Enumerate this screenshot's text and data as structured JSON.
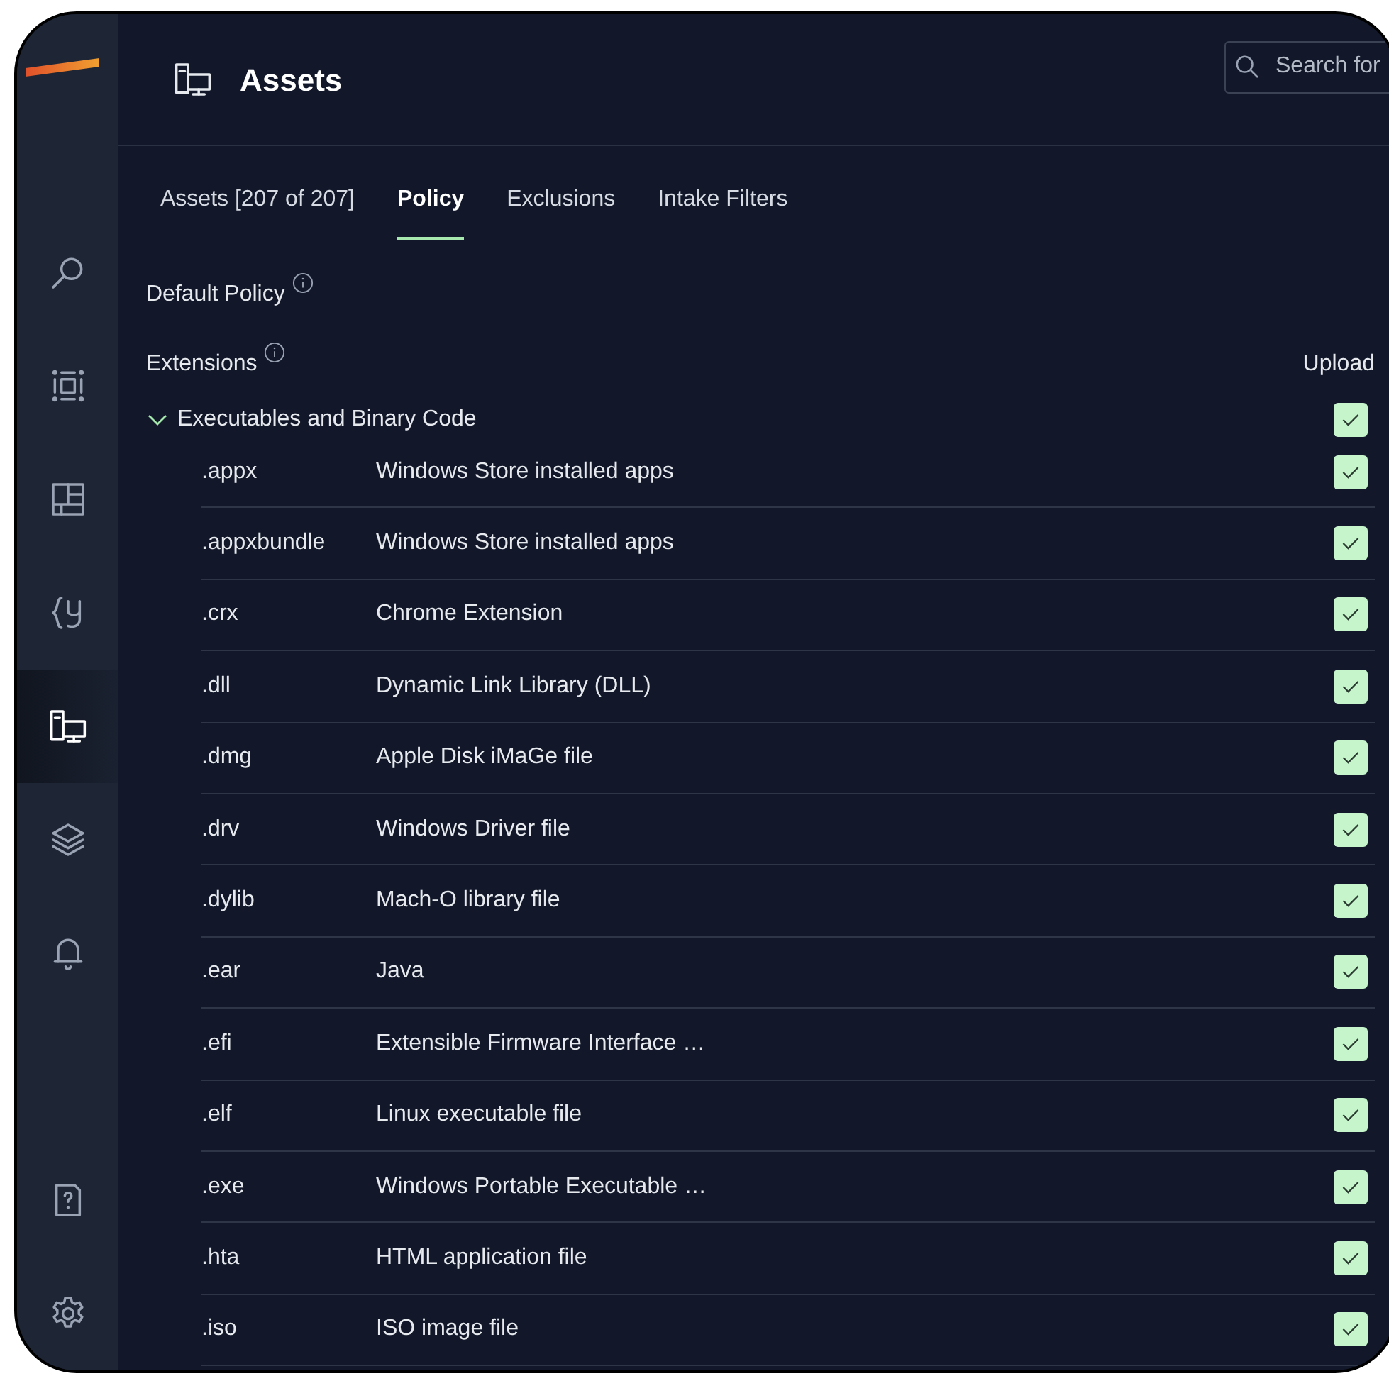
{
  "sidebar": {
    "items": [
      {
        "kind": "search",
        "selected": false
      },
      {
        "kind": "scan",
        "selected": false
      },
      {
        "kind": "dashboard",
        "selected": false
      },
      {
        "kind": "rules",
        "selected": false
      },
      {
        "kind": "assets",
        "selected": true
      },
      {
        "kind": "layers",
        "selected": false
      },
      {
        "kind": "alerts",
        "selected": false
      },
      {
        "kind": "help",
        "selected": false
      },
      {
        "kind": "settings",
        "selected": false
      }
    ]
  },
  "header": {
    "title": "Assets",
    "search": {
      "placeholder": "Search for"
    }
  },
  "tabs": [
    {
      "label": "Assets [207 of 207]",
      "selected": false
    },
    {
      "label": "Policy",
      "selected": true
    },
    {
      "label": "Exclusions",
      "selected": false
    },
    {
      "label": "Intake Filters",
      "selected": false
    }
  ],
  "default_policy": {
    "label": "Default Policy"
  },
  "extensions": {
    "label": "Extensions",
    "column": "Upload",
    "groups": [
      {
        "label": "Executables and Binary Code",
        "expanded": true,
        "checked": true,
        "items": [
          {
            "ext": ".appx",
            "description": "Windows Store installed apps",
            "checked": true
          },
          {
            "ext": ".appxbundle",
            "description": "Windows Store installed apps",
            "checked": true
          },
          {
            "ext": ".crx",
            "description": "Chrome Extension",
            "checked": true
          },
          {
            "ext": ".dll",
            "description": "Dynamic Link Library (DLL)",
            "checked": true
          },
          {
            "ext": ".dmg",
            "description": "Apple Disk iMaGe file",
            "checked": true
          },
          {
            "ext": ".drv",
            "description": "Windows Driver file",
            "checked": true
          },
          {
            "ext": ".dylib",
            "description": "Mach-O library file",
            "checked": true
          },
          {
            "ext": ".ear",
            "description": "Java",
            "checked": true
          },
          {
            "ext": ".efi",
            "description": "Extensible Firmware Interface …",
            "checked": true
          },
          {
            "ext": ".elf",
            "description": "Linux executable file",
            "checked": true
          },
          {
            "ext": ".exe",
            "description": "Windows Portable Executable …",
            "checked": true
          },
          {
            "ext": ".hta",
            "description": "HTML application file",
            "checked": true
          },
          {
            "ext": ".iso",
            "description": "ISO image file",
            "checked": true
          }
        ]
      }
    ]
  }
}
